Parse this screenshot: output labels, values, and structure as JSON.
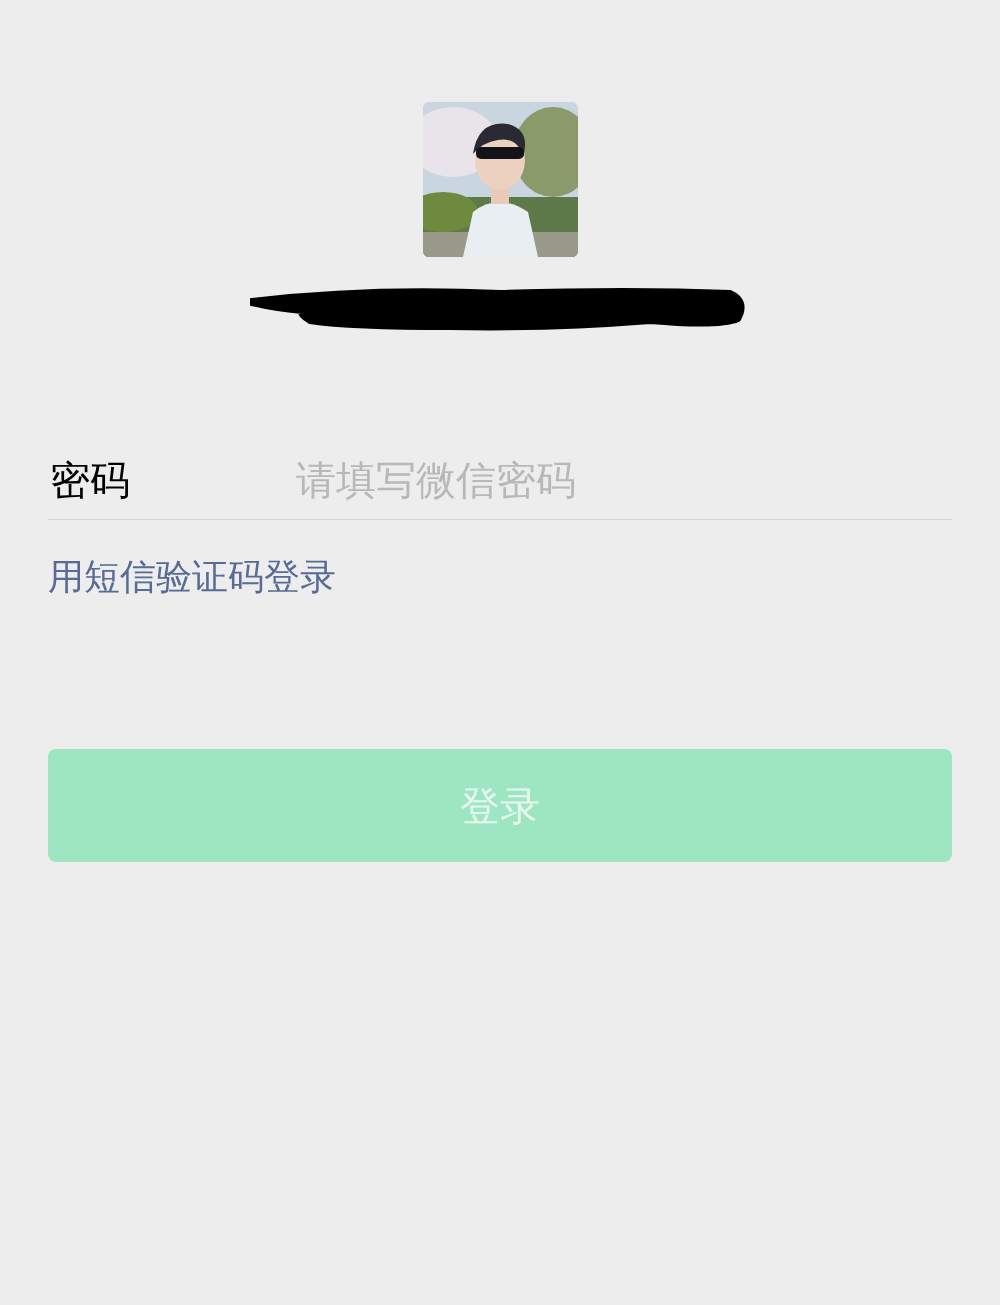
{
  "password": {
    "label": "密码",
    "placeholder": "请填写微信密码"
  },
  "sms_login_link": "用短信验证码登录",
  "login_button": {
    "label": "登录",
    "disabled": true
  }
}
